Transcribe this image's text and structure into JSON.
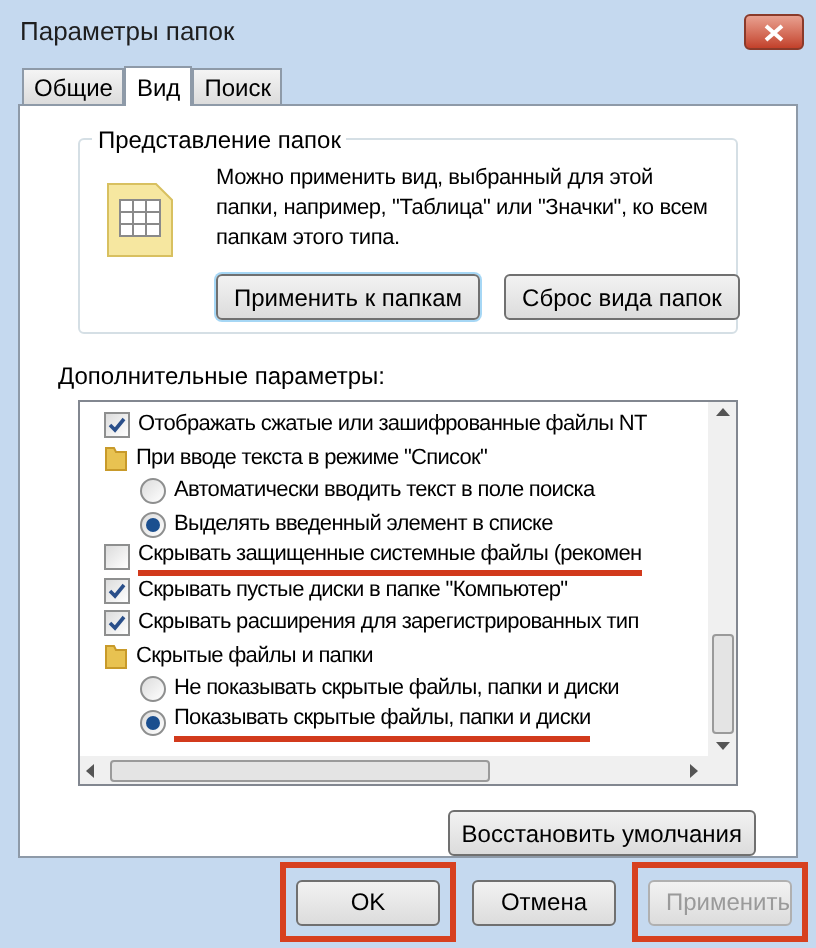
{
  "window": {
    "title": "Параметры папок"
  },
  "tabs": [
    {
      "label": "Общие",
      "selected": false
    },
    {
      "label": "Вид",
      "selected": true
    },
    {
      "label": "Поиск",
      "selected": false
    }
  ],
  "folder_views": {
    "title": "Представление папок",
    "description": "Можно применить вид, выбранный для этой папки, например, \"Таблица\" или \"Значки\", ко всем папкам этого типа.",
    "buttons": [
      {
        "label": "Применить к папкам",
        "focused": true
      },
      {
        "label": "Сброс вида папок",
        "focused": false
      }
    ]
  },
  "advanced": {
    "title": "Дополнительные параметры:",
    "items": [
      {
        "kind": "checkbox",
        "label": "Отображать сжатые или зашифрованные файлы NT",
        "checked": true,
        "underlined": false
      },
      {
        "kind": "folder",
        "label": "При вводе текста в режиме \"Список\"",
        "underlined": false,
        "children": [
          {
            "kind": "radio",
            "label": "Автоматически вводить текст в поле поиска",
            "selected": false,
            "underlined": false
          },
          {
            "kind": "radio",
            "label": "Выделять введенный элемент в списке",
            "selected": true,
            "underlined": false
          }
        ]
      },
      {
        "kind": "checkbox",
        "label": "Скрывать защищенные системные файлы (рекомен",
        "checked": false,
        "underlined": true
      },
      {
        "kind": "checkbox",
        "label": "Скрывать пустые диски в папке \"Компьютер\"",
        "checked": true,
        "underlined": false
      },
      {
        "kind": "checkbox",
        "label": "Скрывать расширения для зарегистрированных тип",
        "checked": true,
        "underlined": false
      },
      {
        "kind": "folder",
        "label": "Скрытые файлы и папки",
        "underlined": false,
        "children": [
          {
            "kind": "radio",
            "label": "Не показывать скрытые файлы, папки и диски",
            "selected": false,
            "underlined": false
          },
          {
            "kind": "radio",
            "label": "Показывать скрытые файлы, папки и диски",
            "selected": true,
            "underlined": true
          }
        ]
      }
    ],
    "restore_button": "Восстановить умолчания"
  },
  "buttons": [
    {
      "label": "OK",
      "disabled": false,
      "highlighted": true
    },
    {
      "label": "Отмена",
      "disabled": false,
      "highlighted": false
    },
    {
      "label": "Применить",
      "disabled": true,
      "highlighted": true
    }
  ]
}
